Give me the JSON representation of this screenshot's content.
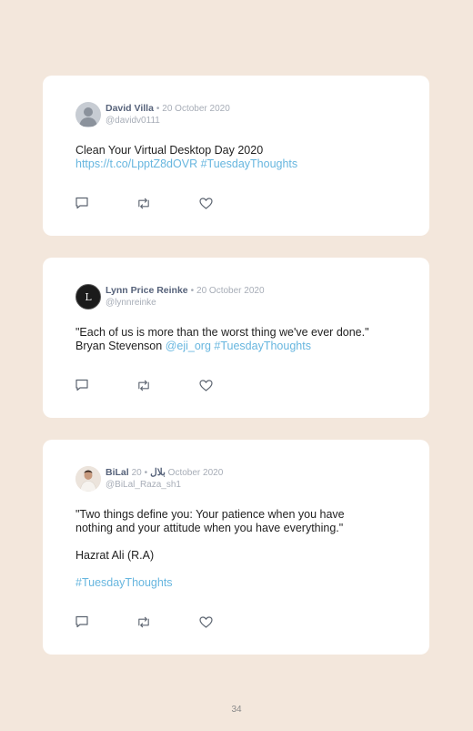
{
  "tweets": [
    {
      "name": "David Villa",
      "separator": "•",
      "date": "20 October 2020",
      "handle": "@davidv0111",
      "line1": "Clean Your Virtual Desktop Day 2020",
      "link1": "https://t.co/LpptZ8dOVR",
      "hashtag": "#TuesdayThoughts",
      "avatar_icon": "default-user-avatar"
    },
    {
      "name": "Lynn Price Reinke",
      "separator": "•",
      "date": "20 October 2020",
      "handle": "@lynnreinke",
      "line1": "\"Each of us is more than the worst thing we've ever done.\"",
      "line2_prefix": "Bryan Stevenson",
      "mention": "@eji_org",
      "hashtag": "#TuesdayThoughts",
      "avatar_icon": "monogram-avatar",
      "avatar_letter": "L"
    },
    {
      "name": "BiLal بلال",
      "separator": "•",
      "date": "20 October 2020",
      "handle": "@BiLal_Raza_sh1",
      "line1": "\"Two things define you: Your patience when you have",
      "line2": "nothing and your attitude when you have everything.\"",
      "attribution": "Hazrat Ali (R.A)",
      "hashtag": "#TuesdayThoughts",
      "avatar_icon": "photo-avatar"
    }
  ],
  "page_number": "34",
  "colors": {
    "background": "#f3e7dc",
    "card": "#ffffff",
    "link": "#67b6df",
    "name": "#56627a",
    "muted": "#a7adb7",
    "icon": "#5c6470"
  },
  "action_icons": [
    "reply-icon",
    "retweet-icon",
    "like-icon"
  ]
}
